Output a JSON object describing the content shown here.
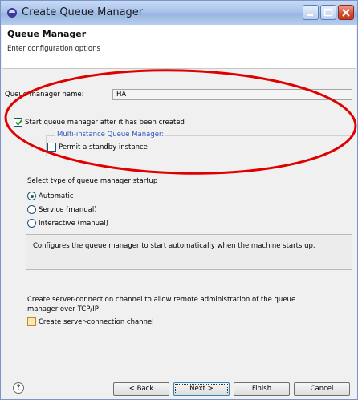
{
  "window": {
    "title": "Create Queue Manager",
    "controls": {
      "minimize": "minimize",
      "maximize": "maximize",
      "close": "close"
    }
  },
  "header": {
    "title": "Queue Manager",
    "subtitle": "Enter configuration options"
  },
  "form": {
    "queue_manager_name_label": "Queue manager name:",
    "queue_manager_name_value": "HA",
    "start_after_create_label": "Start queue manager after it has been created",
    "start_after_create_checked": true,
    "multi_instance_legend": "Multi-instance Queue Manager:",
    "permit_standby_label": "Permit a standby instance",
    "permit_standby_checked": false,
    "startup_type_label": "Select type of queue manager startup",
    "startup_options": [
      {
        "label": "Automatic",
        "selected": true
      },
      {
        "label": "Service (manual)",
        "selected": false
      },
      {
        "label": "Interactive (manual)",
        "selected": false
      }
    ],
    "startup_description": "Configures the queue manager to start automatically when the machine starts up.",
    "channel_info_line1": "Create server-connection channel to allow remote administration of the queue",
    "channel_info_line2": "manager over TCP/IP",
    "create_channel_label": "Create server-connection channel",
    "create_channel_checked": false
  },
  "buttons": {
    "help": "?",
    "back": "< Back",
    "next": "Next >",
    "finish": "Finish",
    "cancel": "Cancel"
  },
  "colors": {
    "annotation": "#e00000",
    "legend": "#2f55b8"
  }
}
